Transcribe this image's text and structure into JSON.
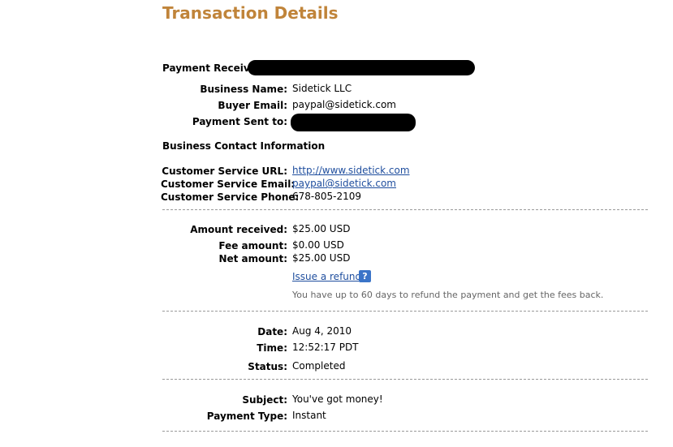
{
  "page": {
    "title": "Transaction Details"
  },
  "summary": {
    "payment_received_label": "Payment Received",
    "business_name_label": "Business Name:",
    "business_name": "Sidetick LLC",
    "buyer_email_label": "Buyer Email:",
    "buyer_email": "paypal@sidetick.com",
    "payment_sent_to_label": "Payment Sent to:"
  },
  "contact": {
    "heading": "Business Contact Information",
    "url_label": "Customer Service URL:",
    "url": "http://www.sidetick.com",
    "email_label": "Customer Service Email:",
    "email": "paypal@sidetick.com",
    "phone_label": "Customer Service Phone:",
    "phone": "678-805-2109"
  },
  "amounts": {
    "received_label": "Amount received:",
    "received": "$25.00 USD",
    "fee_label": "Fee amount:",
    "fee": "$0.00 USD",
    "net_label": "Net amount:",
    "net": "$25.00 USD",
    "refund_link": "Issue a refund",
    "help_icon_text": "?",
    "refund_note": "You have up to 60 days to refund the payment and get the fees back."
  },
  "details": {
    "date_label": "Date:",
    "date": "Aug 4, 2010",
    "time_label": "Time:",
    "time": "12:52:17 PDT",
    "status_label": "Status:",
    "status": "Completed"
  },
  "message": {
    "subject_label": "Subject:",
    "subject": "You've got money!",
    "type_label": "Payment Type:",
    "type": "Instant"
  }
}
